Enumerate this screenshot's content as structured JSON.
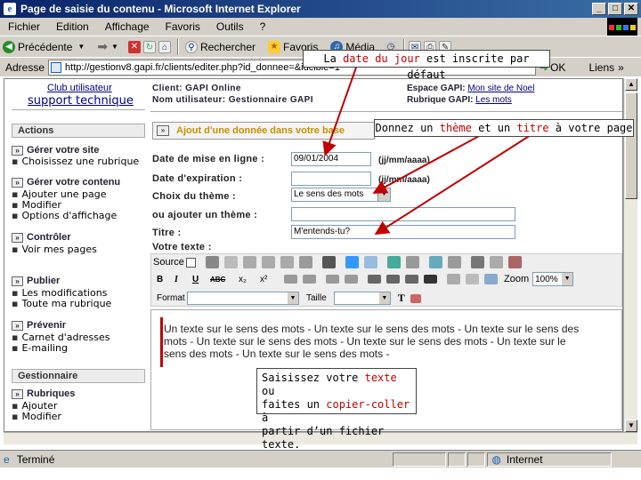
{
  "window": {
    "title": "Page de saisie du contenu - Microsoft Internet Explorer"
  },
  "menu": {
    "items": [
      "Fichier",
      "Edition",
      "Affichage",
      "Favoris",
      "Outils",
      "?"
    ]
  },
  "toolbar": {
    "back": "Précédente",
    "search": "Rechercher",
    "favorites": "Favoris",
    "media": "Média"
  },
  "address": {
    "label": "Adresse",
    "url": "http://gestionv8.gapi.fr/clients/editer.php?id_donnee=&idcible=1",
    "go": "OK",
    "links": "Liens"
  },
  "header": {
    "club": "Club utilisateur",
    "support": "support technique",
    "client_label": "Client:",
    "client_value": "GAPI Online",
    "user_label": "Nom utilisateur:",
    "user_value": "Gestionnaire GAPI",
    "space_label": "Espace GAPI:",
    "space_link": "Mon site de Noel",
    "rubric_label": "Rubrique GAPI:",
    "rubric_link": "Les mots"
  },
  "sidebar": {
    "actions": "Actions",
    "sections": [
      {
        "title": "Gérer votre site",
        "items": [
          "Choisissez une rubrique"
        ]
      },
      {
        "title": "Gérer votre contenu",
        "items": [
          "Ajouter une page",
          "Modifier",
          "Options d'affichage"
        ]
      },
      {
        "title": "Contrôler",
        "items": [
          "Voir mes pages"
        ]
      },
      {
        "title": "Publier",
        "items": [
          "Les modifications",
          "Toute ma rubrique"
        ]
      },
      {
        "title": "Prévenir",
        "items": [
          "Carnet d'adresses",
          "E-mailing"
        ]
      }
    ],
    "gestionnaire": "Gestionnaire",
    "rubriques": {
      "title": "Rubriques",
      "items": [
        "Ajouter",
        "Modifier"
      ]
    }
  },
  "form": {
    "heading": "Ajout d'une donnée dans votre base",
    "date_label": "Date de mise en ligne :",
    "date_value": "09/01/2004",
    "date_hint": "(jj/mm/aaaa)",
    "expiry_label": "Date d'expiration :",
    "expiry_value": "",
    "expiry_hint": "(jj/mm/aaaa)",
    "theme_label": "Choix du thème :",
    "theme_value": "Le sens des mots",
    "add_theme_label": "ou ajouter un thème :",
    "add_theme_value": "",
    "title_label": "Titre :",
    "title_value": "M'entends-tu?",
    "text_label": "Votre texte :"
  },
  "editor": {
    "source": "Source",
    "zoom_label": "Zoom",
    "zoom_value": "100%",
    "format_label": "Format",
    "size_label": "Taille",
    "content": "Un texte sur le sens des mots - Un texte sur le sens des mots - Un texte sur le sens des mots - Un texte sur le sens des mots - Un texte sur le sens des mots - Un texte sur le sens des mots - Un texte sur le sens des mots -"
  },
  "callouts": {
    "date_pre": "La ",
    "date_red": "date du jour",
    "date_post": " est inscrite par défaut",
    "theme_pre": "Donnez un ",
    "theme_red1": "thème",
    "theme_mid": " et un ",
    "theme_red2": "titre",
    "theme_post": " à votre page",
    "text_l1_pre": "Saisissez votre ",
    "text_l1_red": "texte",
    "text_l1_post": " ou",
    "text_l2_pre": "faites un ",
    "text_l2_red": "copier-coller",
    "text_l2_post": " à",
    "text_l3": "partir d’un fichier texte."
  },
  "status": {
    "left": "Terminé",
    "zone": "Internet"
  },
  "colors": {
    "title_bar": "#0a246a",
    "chrome": "#d4d0c8",
    "link": "#000080",
    "highlight": "#c00000",
    "arrow": "#c00000"
  }
}
